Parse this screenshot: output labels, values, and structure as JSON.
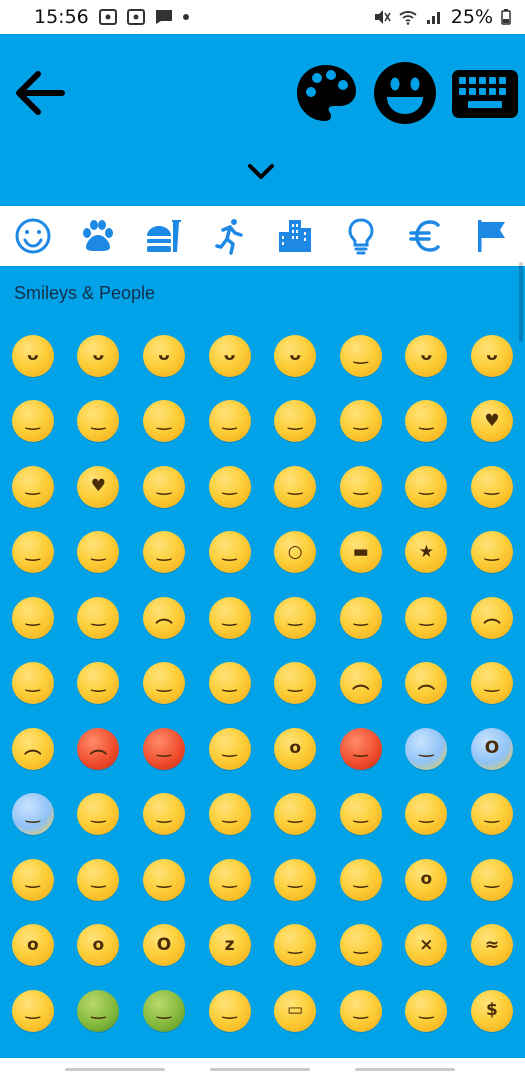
{
  "status_bar": {
    "time": "15:56",
    "battery": "25%",
    "icons_left": [
      "screenshot-icon",
      "screenshot-icon",
      "message-icon",
      "dot-icon"
    ],
    "icons_right": [
      "mute-icon",
      "wifi-icon",
      "signal-icon",
      "battery-icon"
    ]
  },
  "toolbar": {
    "back": "back-arrow-icon",
    "palette": "palette-icon",
    "face": "smiley-face-icon",
    "keyboard": "keyboard-icon",
    "chevron": "chevron-down-icon"
  },
  "categories": [
    {
      "name": "smileys",
      "icon": "smiley-outline-icon",
      "selected": true
    },
    {
      "name": "animals",
      "icon": "paw-icon"
    },
    {
      "name": "food",
      "icon": "burger-icon"
    },
    {
      "name": "activity",
      "icon": "running-person-icon"
    },
    {
      "name": "travel",
      "icon": "buildings-icon"
    },
    {
      "name": "objects",
      "icon": "lightbulb-icon"
    },
    {
      "name": "symbols",
      "icon": "euro-icon"
    },
    {
      "name": "flags",
      "icon": "flag-icon"
    }
  ],
  "section": {
    "title": "Smileys & People"
  },
  "colors": {
    "background": "#02a2e8",
    "icon_blue": "#1e88e5",
    "category_bar": "#ffffff"
  },
  "emoji_rows": [
    [
      "grinning",
      "smiley",
      "smile",
      "grin",
      "laughing",
      "sweat_smile",
      "joy",
      "rofl"
    ],
    [
      "blush_relaxed",
      "blush",
      "innocent",
      "slightly_smiling",
      "upside_down",
      "wink",
      "relieved",
      "heart_eyes"
    ],
    [
      "smiling_hearts",
      "kissing_heart",
      "kissing",
      "kissing_smiling_eyes",
      "kissing_closed_eyes",
      "yum",
      "stuck_out_tongue",
      "stuck_out_tongue_closed_eyes"
    ],
    [
      "stuck_out_tongue_winking_eye",
      "zany",
      "raised_eyebrow",
      "monocle",
      "nerd",
      "sunglasses",
      "star_struck",
      "partying"
    ],
    [
      "smirk",
      "unamused",
      "disappointed",
      "pensive",
      "worried",
      "confused",
      "slightly_frowning",
      "frowning"
    ],
    [
      "persevere",
      "confounded",
      "tired",
      "weary",
      "pleading",
      "cry",
      "sob",
      "triumph"
    ],
    [
      "angry",
      "rage",
      "cursing",
      "exploding_head",
      "flushed",
      "hot",
      "cold",
      "scream"
    ],
    [
      "fearful",
      "cold_sweat",
      "disappointed_relieved",
      "sweat",
      "hugging",
      "thinking",
      "hand_over_mouth",
      "shushing"
    ],
    [
      "lying",
      "no_mouth",
      "neutral",
      "expressionless",
      "grimacing",
      "rolling_eyes",
      "hushed",
      "frowning_open_mouth"
    ],
    [
      "anguished",
      "open_mouth",
      "astonished",
      "sleeping",
      "drooling",
      "sleepy",
      "dizzy",
      "zipper_mouth"
    ],
    [
      "woozy",
      "nauseated",
      "vomiting",
      "sneezing",
      "mask",
      "thermometer_face",
      "head_bandage",
      "money_mouth"
    ]
  ]
}
